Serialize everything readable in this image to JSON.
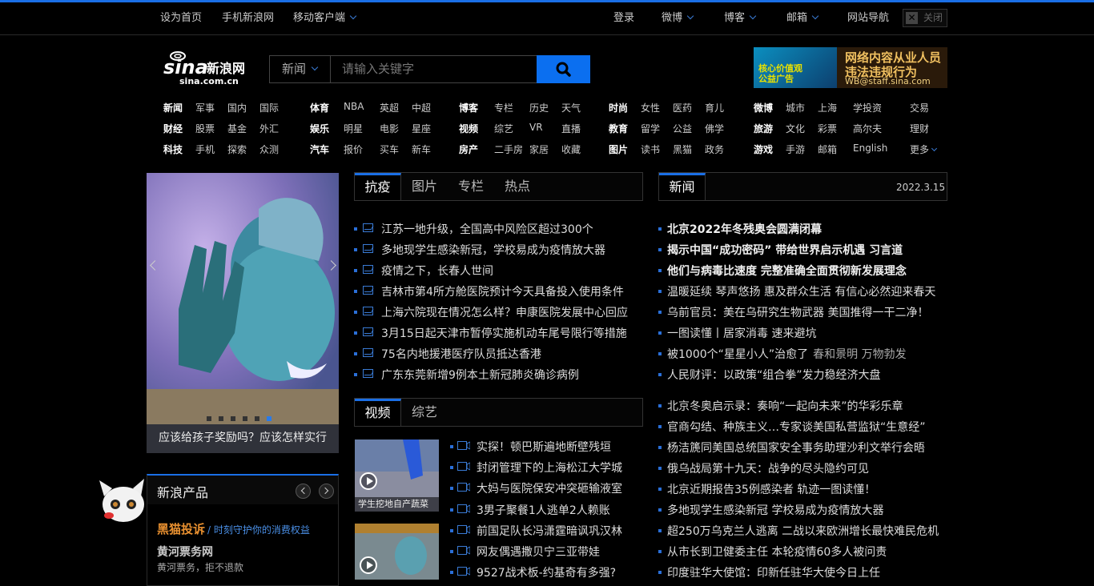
{
  "topbar": {
    "left": [
      "设为首页",
      "手机新浪网",
      "移动客户端"
    ],
    "right": {
      "login": "登录",
      "weibo": "微博",
      "blog": "博客",
      "mail": "邮箱",
      "sitenav": "网站导航",
      "close": "关闭"
    }
  },
  "logo": {
    "brand": "sina新浪网",
    "domain": "sina.com.cn"
  },
  "search": {
    "category": "新闻",
    "placeholder": "请输入关键字"
  },
  "ad": {
    "left_text_1": "核心价值观",
    "left_text_2": "公益广告",
    "line1": "网络内容从业人员",
    "line2": "违法违规行为",
    "email": "WB@staff.sina.com"
  },
  "nav": {
    "col1": [
      [
        "新闻",
        "军事",
        "国内",
        "国际"
      ],
      [
        "财经",
        "股票",
        "基金",
        "外汇"
      ],
      [
        "科技",
        "手机",
        "探索",
        "众测"
      ]
    ],
    "col2": [
      [
        "体育",
        "NBA",
        "英超",
        "中超"
      ],
      [
        "娱乐",
        "明星",
        "电影",
        "星座"
      ],
      [
        "汽车",
        "报价",
        "买车",
        "新车"
      ]
    ],
    "col3": [
      [
        "博客",
        "专栏",
        "历史",
        "天气"
      ],
      [
        "视频",
        "综艺",
        "VR",
        "直播"
      ],
      [
        "房产",
        "二手房",
        "家居",
        "收藏"
      ]
    ],
    "col4": [
      [
        "时尚",
        "女性",
        "医药",
        "育儿"
      ],
      [
        "教育",
        "留学",
        "公益",
        "佛学"
      ],
      [
        "图片",
        "读书",
        "黑猫",
        "政务"
      ]
    ],
    "col5": [
      [
        "微博",
        "城市",
        "上海",
        "学投资"
      ],
      [
        "旅游",
        "文化",
        "彩票",
        "高尔夫"
      ],
      [
        "游戏",
        "手游",
        "邮箱",
        "English"
      ]
    ],
    "col6": [
      "交易",
      "理财",
      "更多"
    ]
  },
  "slider": {
    "caption": "应该给孩子奖励吗？应该怎样实行",
    "dot_count": 6,
    "active_dot": 5
  },
  "products": {
    "title": "新浪产品",
    "p1": "黑猫投诉",
    "p1_slogan": "/ 时刻守护你的消费权益",
    "p2": "黄河票务网",
    "p3": "黄河票务，拒不退款"
  },
  "tabs1": {
    "items": [
      "抗疫",
      "图片",
      "专栏",
      "热点"
    ]
  },
  "epidemic_news": [
    "江苏一地升级，全国高中风险区超过300个",
    "多地现学生感染新冠，学校易成为疫情放大器",
    "疫情之下，长春人世间",
    "吉林市第4所方舱医院预计今天具备投入使用条件",
    "上海六院现在情况怎么样？申康医院发展中心回应",
    "3月15日起天津市暂停实施机动车尾号限行等措施",
    "75名内地援港医疗队员抵达香港",
    "广东东莞新增9例本土新冠肺炎确诊病例"
  ],
  "tabs2": {
    "items": [
      "视频",
      "综艺"
    ]
  },
  "video_thumbs": [
    {
      "caption": "学生挖地自产蔬菜"
    },
    {
      "caption": ""
    }
  ],
  "video_news": [
    "实探！顿巴斯遍地断壁残垣",
    "封闭管理下的上海松江大学城",
    "大妈与医院保安冲突砸输液室",
    "3男子聚餐1人逃单2人赖账",
    "前国足队长冯潇霆暗讽巩汉林",
    "网友偶遇撒贝宁三亚带娃",
    "9527战术板-约基奇有多强?"
  ],
  "news_tab": {
    "label": "新闻",
    "date": "2022.3.15"
  },
  "headlines": [
    {
      "text": "北京2022年冬残奥会圆满闭幕",
      "bold": true
    },
    {
      "text": "揭示中国“成功密码” 带给世界启示机遇 习言道",
      "bold": true
    },
    {
      "text": "他们与病毒比速度 完整准确全面贯彻新发展理念",
      "bold": true
    },
    {
      "text": "温暖延续 琴声悠扬 惠及群众生活 有信心必然迎来春天",
      "bold": false
    },
    {
      "text": "乌前官员：美在乌研究生物武器 美国推得一干二净！",
      "bold": false
    },
    {
      "text": "一图读懂丨居家消毒 速来避坑",
      "bold": false
    },
    {
      "text": "被1000个“星星小人”治愈了",
      "dim": "春和景明 万物勃发",
      "bold": false
    },
    {
      "text": "人民财评：以政策“组合拳”发力稳经济大盘",
      "bold": false
    }
  ],
  "news2": [
    "北京冬奥启示录：奏响“一起向未来”的华彩乐章",
    "官商勾结、种族主义…专家谈美国私营监狱“生意经”",
    "杨洁篪同美国总统国家安全事务助理沙利文举行会晤",
    "俄乌战局第十九天：战争的尽头隐约可见",
    "北京近期报告35例感染者 轨迹一图读懂！",
    "多地现学生感染新冠 学校易成为疫情放大器",
    "超250万乌克兰人逃离 二战以来欧洲增长最快难民危机",
    "从市长到卫健委主任 本轮疫情60多人被问责",
    "印度驻华大使馆：印新任驻华大使今日上任"
  ],
  "colors": {
    "accent": "#1a6fe6",
    "background": "#000000",
    "search_button": "#0b6ff0"
  },
  "icons": [
    "chevron-down-icon",
    "search-icon",
    "close-icon",
    "image-icon",
    "video-icon",
    "play-icon",
    "arrow-left-icon",
    "arrow-right-icon"
  ]
}
